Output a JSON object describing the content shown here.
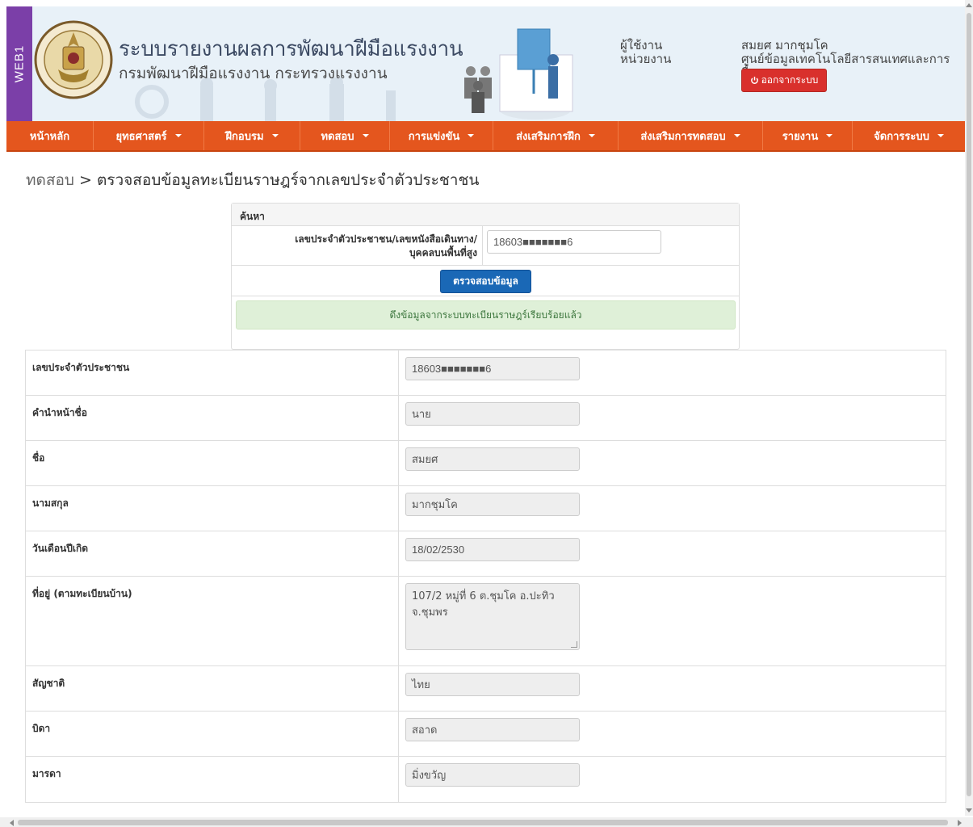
{
  "header": {
    "tag": "WEB1",
    "title": "ระบบรายงานผลการพัฒนาฝีมือแรงงาน",
    "subtitle": "กรมพัฒนาฝีมือแรงงาน กระทรวงแรงงาน",
    "user_label": "ผู้ใช้งาน",
    "unit_label": "หน่วยงาน",
    "user_name": "สมยศ มากชุมโค",
    "unit_name": "ศูนย์ข้อมูลเทคโนโลยีสารสนเทศและการสื่อสาร",
    "logout_label": "ออกจากระบบ",
    "logout_icon": "power-icon",
    "colors": {
      "tag": "#7b3fa8",
      "header_bg": "#e8f1f8",
      "logout": "#d9302c"
    }
  },
  "nav": {
    "color": "#e4561e",
    "items": [
      {
        "label": "หน้าหลัก",
        "dropdown": false
      },
      {
        "label": "ยุทธศาสตร์",
        "dropdown": true
      },
      {
        "label": "ฝึกอบรม",
        "dropdown": true
      },
      {
        "label": "ทดสอบ",
        "dropdown": true
      },
      {
        "label": "การแข่งขัน",
        "dropdown": true
      },
      {
        "label": "ส่งเสริมการฝึก",
        "dropdown": true
      },
      {
        "label": "ส่งเสริมการทดสอบ",
        "dropdown": true
      },
      {
        "label": "รายงาน",
        "dropdown": true
      },
      {
        "label": "จัดการระบบ",
        "dropdown": true
      }
    ]
  },
  "breadcrumb": {
    "root": "ทดสอบ",
    "separator": ">",
    "current": "ตรวจสอบข้อมูลทะเบียนราษฎร์จากเลขประจำตัวประชาชน"
  },
  "search": {
    "heading": "ค้นหา",
    "label_line1": "เลขประจำตัวประชาชน/เลขหนังสือเดินทาง/",
    "label_line2": "บุคคลบนพื้นที่สูง",
    "value": "18603■■■■■■■6",
    "button": "ตรวจสอบข้อมูล",
    "button_color": "#1a68b6",
    "alert": "ดึงข้อมูลจากระบบทะเบียนราษฎร์เรียบร้อยแล้ว"
  },
  "details": {
    "id_card": {
      "label": "เลขประจำตัวประชาชน",
      "value": "18603■■■■■■■6"
    },
    "prefix": {
      "label": "คำนำหน้าชื่อ",
      "value": "นาย"
    },
    "first_name": {
      "label": "ชื่อ",
      "value": "สมยศ"
    },
    "last_name": {
      "label": "นามสกุล",
      "value": "มากชุมโค"
    },
    "birth_date": {
      "label": "วันเดือนปีเกิด",
      "value": "18/02/2530"
    },
    "address": {
      "label": "ที่อยู่ (ตามทะเบียนบ้าน)",
      "line1": "107/2  หมู่ที่ 6 ต.ชุมโค อ.ปะทิว",
      "line2": "จ.ชุมพร"
    },
    "nationality": {
      "label": "สัญชาติ",
      "value": "ไทย"
    },
    "father": {
      "label": "บิดา",
      "value": "สอาด"
    },
    "mother": {
      "label": "มารดา",
      "value": "มิ่งขวัญ"
    }
  }
}
